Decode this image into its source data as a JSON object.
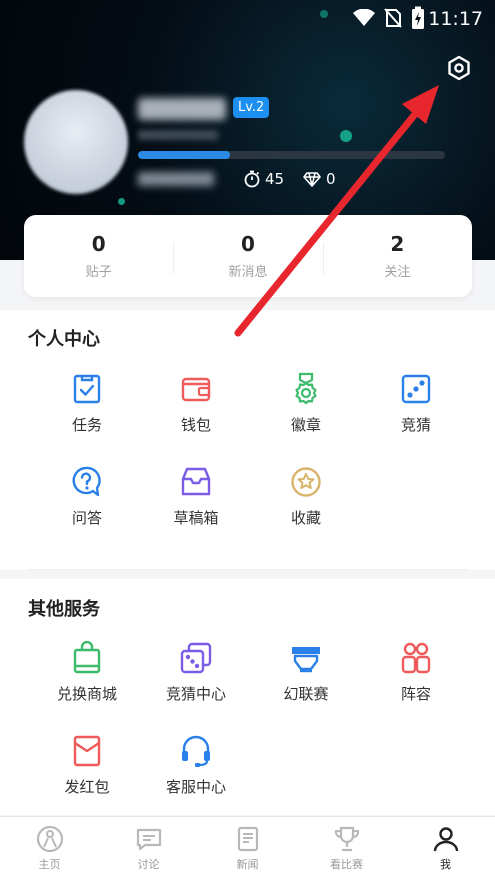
{
  "status_bar": {
    "time": "11:17"
  },
  "profile": {
    "level": "Lv.2",
    "xp_progress": 0.3,
    "stamina": "45",
    "diamonds": "0"
  },
  "counts": [
    {
      "num": "0",
      "label": "贴子"
    },
    {
      "num": "0",
      "label": "新消息"
    },
    {
      "num": "2",
      "label": "关注"
    }
  ],
  "personal": {
    "title": "个人中心",
    "items": [
      {
        "label": "任务",
        "icon": "task-icon"
      },
      {
        "label": "钱包",
        "icon": "wallet-icon"
      },
      {
        "label": "徽章",
        "icon": "badge-icon"
      },
      {
        "label": "竞猜",
        "icon": "dice-icon"
      },
      {
        "label": "问答",
        "icon": "qa-icon"
      },
      {
        "label": "草稿箱",
        "icon": "draft-box-icon"
      },
      {
        "label": "收藏",
        "icon": "star-icon"
      }
    ]
  },
  "services": {
    "title": "其他服务",
    "items": [
      {
        "label": "兑换商城",
        "icon": "shopping-bag-icon"
      },
      {
        "label": "竞猜中心",
        "icon": "guess-center-icon"
      },
      {
        "label": "幻联赛",
        "icon": "league-icon"
      },
      {
        "label": "阵容",
        "icon": "lineup-icon"
      },
      {
        "label": "发红包",
        "icon": "red-packet-icon"
      },
      {
        "label": "客服中心",
        "icon": "headset-icon"
      }
    ]
  },
  "tabs": [
    {
      "label": "主页"
    },
    {
      "label": "讨论"
    },
    {
      "label": "新闻"
    },
    {
      "label": "看比赛"
    },
    {
      "label": "我"
    }
  ],
  "colors": {
    "blue": "#2b80e8",
    "red": "#ef5a5a",
    "green": "#3dbb6c",
    "purple": "#7a5ce6",
    "gold": "#d9b46a",
    "arrow": "#e8262e"
  }
}
